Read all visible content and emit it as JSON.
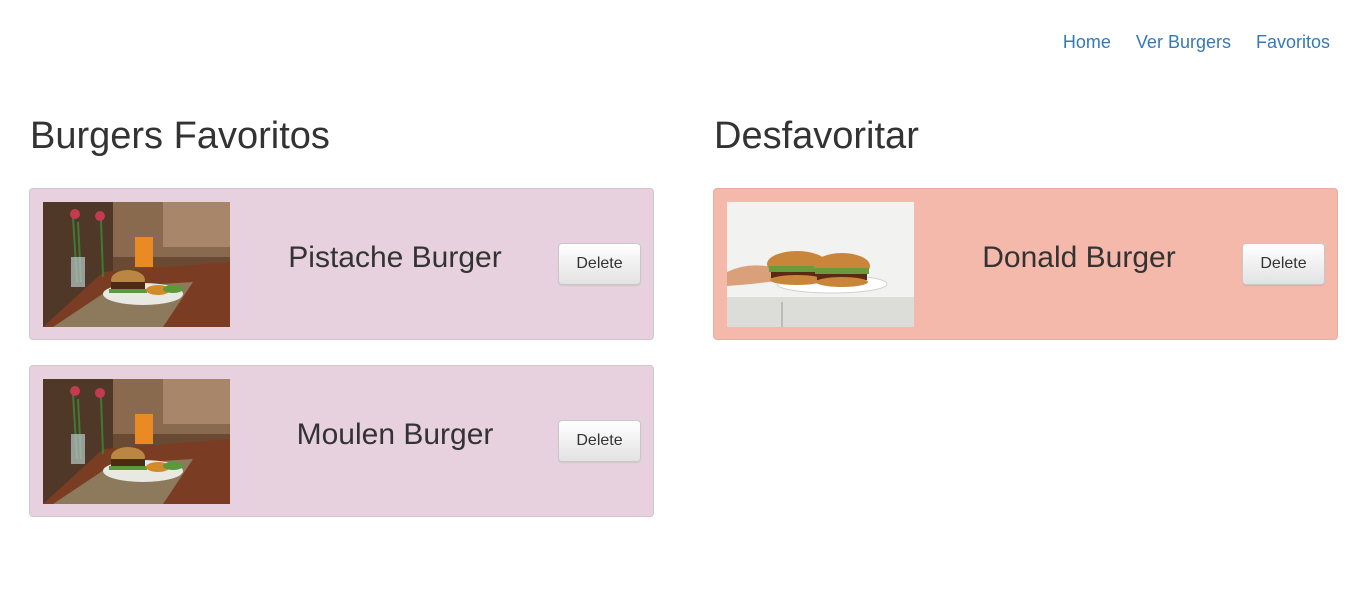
{
  "nav": {
    "items": [
      "Home",
      "Ver Burgers",
      "Favoritos"
    ]
  },
  "favorites": {
    "title": "Burgers Favoritos",
    "items": [
      {
        "name": "Pistache Burger",
        "button": "Delete"
      },
      {
        "name": "Moulen Burger",
        "button": "Delete"
      }
    ]
  },
  "unfavorite": {
    "title": "Desfavoritar",
    "items": [
      {
        "name": "Donald Burger",
        "button": "Delete"
      }
    ]
  },
  "colors": {
    "link": "#337ab7",
    "favorite_card": "#e8d1de",
    "unfavorite_card": "#f4b9ab"
  }
}
